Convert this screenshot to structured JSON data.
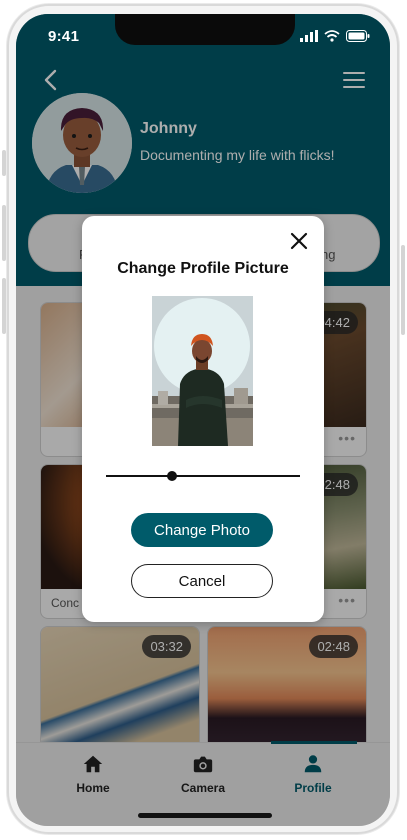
{
  "status_bar": {
    "time": "9:41"
  },
  "profile": {
    "name": "Johnny",
    "bio": "Documenting my life with flicks!",
    "stats_left_fragment": "F",
    "stats_right_fragment": "ng"
  },
  "videos": [
    {
      "duration": "",
      "title": ""
    },
    {
      "duration": "04:42",
      "title": ""
    },
    {
      "duration": "",
      "title": "Conc"
    },
    {
      "duration": "02:48",
      "title": ""
    },
    {
      "duration": "03:32",
      "title": ""
    },
    {
      "duration": "02:48",
      "title": ""
    }
  ],
  "more_glyph": "•••",
  "nav": {
    "home": "Home",
    "camera": "Camera",
    "profile": "Profile",
    "active": "Profile"
  },
  "modal": {
    "title": "Change Profile Picture",
    "zoom_fraction": 0.34,
    "primary_button": "Change Photo",
    "secondary_button": "Cancel"
  },
  "colors": {
    "brand": "#005b6a",
    "overlay": "rgba(0,0,0,0.32)"
  },
  "icons": {
    "back": "chevron-left-icon",
    "menu": "hamburger-menu-icon",
    "close": "close-icon",
    "home": "home-icon",
    "camera": "camera-icon",
    "profile": "person-icon"
  }
}
